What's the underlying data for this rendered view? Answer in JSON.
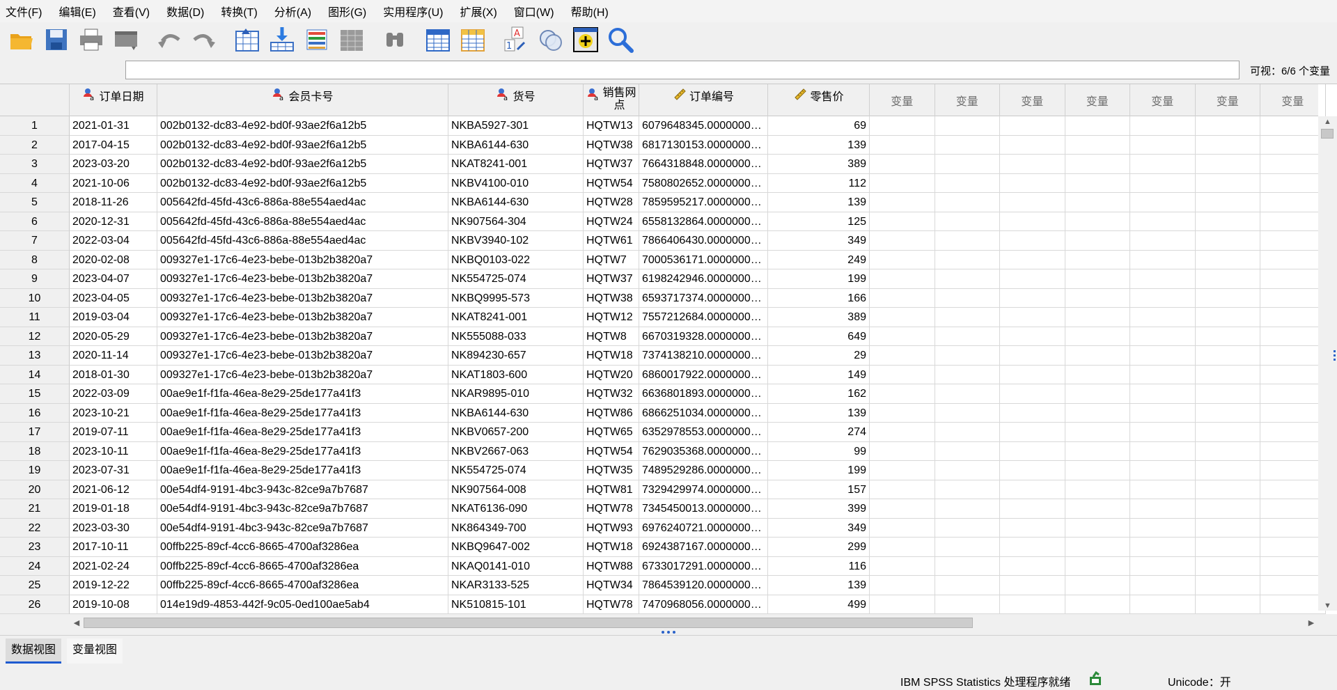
{
  "menu": [
    "文件(F)",
    "编辑(E)",
    "查看(V)",
    "数据(D)",
    "转换(T)",
    "分析(A)",
    "图形(G)",
    "实用程序(U)",
    "扩展(X)",
    "窗口(W)",
    "帮助(H)"
  ],
  "toolbar_icons": [
    "open-folder-icon",
    "save-icon",
    "print-icon",
    "recall-dialog-icon",
    "undo-icon",
    "redo-icon",
    "goto-case-icon",
    "goto-variable-icon",
    "variables-icon",
    "run-descriptives-icon",
    "find-icon",
    "insert-cases-icon",
    "insert-variable-icon",
    "split-file-icon",
    "value-labels-icon",
    "use-sets-icon",
    "spelling-icon",
    "search-icon"
  ],
  "visible_count": "可视：6/6 个变量",
  "columns": [
    "订单日期",
    "会员卡号",
    "货号",
    "销售网点",
    "订单编号",
    "零售价"
  ],
  "empty_column_label": "变量",
  "rows": [
    [
      "1",
      "2021-01-31",
      "002b0132-dc83-4e92-bd0f-93ae2f6a12b5",
      "NKBA5927-301",
      "HQTW13",
      "6079648345.00000000...",
      "69"
    ],
    [
      "2",
      "2017-04-15",
      "002b0132-dc83-4e92-bd0f-93ae2f6a12b5",
      "NKBA6144-630",
      "HQTW38",
      "6817130153.00000000...",
      "139"
    ],
    [
      "3",
      "2023-03-20",
      "002b0132-dc83-4e92-bd0f-93ae2f6a12b5",
      "NKAT8241-001",
      "HQTW37",
      "7664318848.00000000...",
      "389"
    ],
    [
      "4",
      "2021-10-06",
      "002b0132-dc83-4e92-bd0f-93ae2f6a12b5",
      "NKBV4100-010",
      "HQTW54",
      "7580802652.00000000...",
      "112"
    ],
    [
      "5",
      "2018-11-26",
      "005642fd-45fd-43c6-886a-88e554aed4ac",
      "NKBA6144-630",
      "HQTW28",
      "7859595217.00000000...",
      "139"
    ],
    [
      "6",
      "2020-12-31",
      "005642fd-45fd-43c6-886a-88e554aed4ac",
      "NK907564-304",
      "HQTW24",
      "6558132864.00000000...",
      "125"
    ],
    [
      "7",
      "2022-03-04",
      "005642fd-45fd-43c6-886a-88e554aed4ac",
      "NKBV3940-102",
      "HQTW61",
      "7866406430.00000000...",
      "349"
    ],
    [
      "8",
      "2020-02-08",
      "009327e1-17c6-4e23-bebe-013b2b3820a7",
      "NKBQ0103-022",
      "HQTW7",
      "7000536171.00000000...",
      "249"
    ],
    [
      "9",
      "2023-04-07",
      "009327e1-17c6-4e23-bebe-013b2b3820a7",
      "NK554725-074",
      "HQTW37",
      "6198242946.00000000...",
      "199"
    ],
    [
      "10",
      "2023-04-05",
      "009327e1-17c6-4e23-bebe-013b2b3820a7",
      "NKBQ9995-573",
      "HQTW38",
      "6593717374.00000000...",
      "166"
    ],
    [
      "11",
      "2019-03-04",
      "009327e1-17c6-4e23-bebe-013b2b3820a7",
      "NKAT8241-001",
      "HQTW12",
      "7557212684.00000000...",
      "389"
    ],
    [
      "12",
      "2020-05-29",
      "009327e1-17c6-4e23-bebe-013b2b3820a7",
      "NK555088-033",
      "HQTW8",
      "6670319328.00000000...",
      "649"
    ],
    [
      "13",
      "2020-11-14",
      "009327e1-17c6-4e23-bebe-013b2b3820a7",
      "NK894230-657",
      "HQTW18",
      "7374138210.00000000...",
      "29"
    ],
    [
      "14",
      "2018-01-30",
      "009327e1-17c6-4e23-bebe-013b2b3820a7",
      "NKAT1803-600",
      "HQTW20",
      "6860017922.00000000...",
      "149"
    ],
    [
      "15",
      "2022-03-09",
      "00ae9e1f-f1fa-46ea-8e29-25de177a41f3",
      "NKAR9895-010",
      "HQTW32",
      "6636801893.00000000...",
      "162"
    ],
    [
      "16",
      "2023-10-21",
      "00ae9e1f-f1fa-46ea-8e29-25de177a41f3",
      "NKBA6144-630",
      "HQTW86",
      "6866251034.00000000...",
      "139"
    ],
    [
      "17",
      "2019-07-11",
      "00ae9e1f-f1fa-46ea-8e29-25de177a41f3",
      "NKBV0657-200",
      "HQTW65",
      "6352978553.00000000...",
      "274"
    ],
    [
      "18",
      "2023-10-11",
      "00ae9e1f-f1fa-46ea-8e29-25de177a41f3",
      "NKBV2667-063",
      "HQTW54",
      "7629035368.00000000...",
      "99"
    ],
    [
      "19",
      "2023-07-31",
      "00ae9e1f-f1fa-46ea-8e29-25de177a41f3",
      "NK554725-074",
      "HQTW35",
      "7489529286.00000000...",
      "199"
    ],
    [
      "20",
      "2021-06-12",
      "00e54df4-9191-4bc3-943c-82ce9a7b7687",
      "NK907564-008",
      "HQTW81",
      "7329429974.00000000...",
      "157"
    ],
    [
      "21",
      "2019-01-18",
      "00e54df4-9191-4bc3-943c-82ce9a7b7687",
      "NKAT6136-090",
      "HQTW78",
      "7345450013.00000000...",
      "399"
    ],
    [
      "22",
      "2023-03-30",
      "00e54df4-9191-4bc3-943c-82ce9a7b7687",
      "NK864349-700",
      "HQTW93",
      "6976240721.00000000...",
      "349"
    ],
    [
      "23",
      "2017-10-11",
      "00ffb225-89cf-4cc6-8665-4700af3286ea",
      "NKBQ9647-002",
      "HQTW18",
      "6924387167.00000000...",
      "299"
    ],
    [
      "24",
      "2021-02-24",
      "00ffb225-89cf-4cc6-8665-4700af3286ea",
      "NKAQ0141-010",
      "HQTW88",
      "6733017291.00000000...",
      "116"
    ],
    [
      "25",
      "2019-12-22",
      "00ffb225-89cf-4cc6-8665-4700af3286ea",
      "NKAR3133-525",
      "HQTW34",
      "7864539120.00000000...",
      "139"
    ],
    [
      "26",
      "2019-10-08",
      "014e19d9-4853-442f-9c05-0ed100ae5ab4",
      "NK510815-101",
      "HQTW78",
      "7470968056.00000000...",
      "499"
    ]
  ],
  "tabs": {
    "data_view": "数据视图",
    "variable_view": "变量视图"
  },
  "status": {
    "processor": "IBM SPSS Statistics 处理程序就绪",
    "unicode": "Unicode：开"
  },
  "colors": {
    "accent": "#1e5bd0",
    "grid_line": "#d8d8d8"
  }
}
